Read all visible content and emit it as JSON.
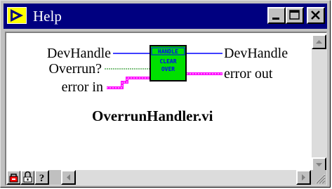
{
  "window": {
    "title": "Help"
  },
  "diagram": {
    "inputs": [
      "DevHandle",
      "Overrun?",
      "error in"
    ],
    "outputs": [
      "DevHandle",
      "error out"
    ],
    "icon_lines": [
      "HANDLE",
      "CLEAR",
      "OVER"
    ],
    "vi_name": "OverrunHandler.vi"
  },
  "colors": {
    "titlebar": "#000080",
    "wire_handle": "#0000ff",
    "wire_bool": "#008000",
    "wire_error": "#ff00ff",
    "icon_fill": "#00e000"
  },
  "icons": [
    "labview-help-icon",
    "minimize-icon",
    "maximize-icon",
    "close-icon",
    "lock-icon",
    "lock-icon",
    "question-icon",
    "arrow-left-icon",
    "arrow-right-icon",
    "arrow-up-icon",
    "arrow-down-icon",
    "resize-grip-icon"
  ]
}
